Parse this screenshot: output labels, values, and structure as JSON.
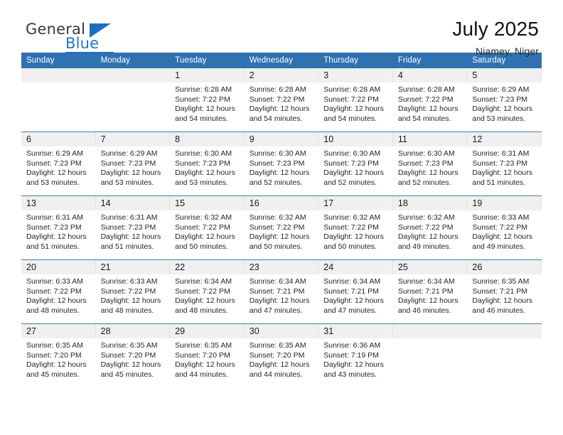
{
  "brand": {
    "name_top": "General",
    "name_bottom": "Blue",
    "accent_color": "#1b6fc0"
  },
  "header": {
    "title": "July 2025",
    "location": "Niamey, Niger",
    "header_bg": "#3071b0",
    "daynum_bg": "#f0f0f0"
  },
  "weekdays": [
    "Sunday",
    "Monday",
    "Tuesday",
    "Wednesday",
    "Thursday",
    "Friday",
    "Saturday"
  ],
  "labels": {
    "sunrise_prefix": "Sunrise:",
    "sunset_prefix": "Sunset:",
    "daylight_prefix": "Daylight:"
  },
  "weeks": [
    [
      {
        "day": "",
        "sunrise": "",
        "sunset": "",
        "daylight": ""
      },
      {
        "day": "",
        "sunrise": "",
        "sunset": "",
        "daylight": ""
      },
      {
        "day": "1",
        "sunrise": "Sunrise: 6:28 AM",
        "sunset": "Sunset: 7:22 PM",
        "daylight": "Daylight: 12 hours and 54 minutes."
      },
      {
        "day": "2",
        "sunrise": "Sunrise: 6:28 AM",
        "sunset": "Sunset: 7:22 PM",
        "daylight": "Daylight: 12 hours and 54 minutes."
      },
      {
        "day": "3",
        "sunrise": "Sunrise: 6:28 AM",
        "sunset": "Sunset: 7:22 PM",
        "daylight": "Daylight: 12 hours and 54 minutes."
      },
      {
        "day": "4",
        "sunrise": "Sunrise: 6:28 AM",
        "sunset": "Sunset: 7:22 PM",
        "daylight": "Daylight: 12 hours and 54 minutes."
      },
      {
        "day": "5",
        "sunrise": "Sunrise: 6:29 AM",
        "sunset": "Sunset: 7:23 PM",
        "daylight": "Daylight: 12 hours and 53 minutes."
      }
    ],
    [
      {
        "day": "6",
        "sunrise": "Sunrise: 6:29 AM",
        "sunset": "Sunset: 7:23 PM",
        "daylight": "Daylight: 12 hours and 53 minutes."
      },
      {
        "day": "7",
        "sunrise": "Sunrise: 6:29 AM",
        "sunset": "Sunset: 7:23 PM",
        "daylight": "Daylight: 12 hours and 53 minutes."
      },
      {
        "day": "8",
        "sunrise": "Sunrise: 6:30 AM",
        "sunset": "Sunset: 7:23 PM",
        "daylight": "Daylight: 12 hours and 53 minutes."
      },
      {
        "day": "9",
        "sunrise": "Sunrise: 6:30 AM",
        "sunset": "Sunset: 7:23 PM",
        "daylight": "Daylight: 12 hours and 52 minutes."
      },
      {
        "day": "10",
        "sunrise": "Sunrise: 6:30 AM",
        "sunset": "Sunset: 7:23 PM",
        "daylight": "Daylight: 12 hours and 52 minutes."
      },
      {
        "day": "11",
        "sunrise": "Sunrise: 6:30 AM",
        "sunset": "Sunset: 7:23 PM",
        "daylight": "Daylight: 12 hours and 52 minutes."
      },
      {
        "day": "12",
        "sunrise": "Sunrise: 6:31 AM",
        "sunset": "Sunset: 7:23 PM",
        "daylight": "Daylight: 12 hours and 51 minutes."
      }
    ],
    [
      {
        "day": "13",
        "sunrise": "Sunrise: 6:31 AM",
        "sunset": "Sunset: 7:23 PM",
        "daylight": "Daylight: 12 hours and 51 minutes."
      },
      {
        "day": "14",
        "sunrise": "Sunrise: 6:31 AM",
        "sunset": "Sunset: 7:23 PM",
        "daylight": "Daylight: 12 hours and 51 minutes."
      },
      {
        "day": "15",
        "sunrise": "Sunrise: 6:32 AM",
        "sunset": "Sunset: 7:22 PM",
        "daylight": "Daylight: 12 hours and 50 minutes."
      },
      {
        "day": "16",
        "sunrise": "Sunrise: 6:32 AM",
        "sunset": "Sunset: 7:22 PM",
        "daylight": "Daylight: 12 hours and 50 minutes."
      },
      {
        "day": "17",
        "sunrise": "Sunrise: 6:32 AM",
        "sunset": "Sunset: 7:22 PM",
        "daylight": "Daylight: 12 hours and 50 minutes."
      },
      {
        "day": "18",
        "sunrise": "Sunrise: 6:32 AM",
        "sunset": "Sunset: 7:22 PM",
        "daylight": "Daylight: 12 hours and 49 minutes."
      },
      {
        "day": "19",
        "sunrise": "Sunrise: 6:33 AM",
        "sunset": "Sunset: 7:22 PM",
        "daylight": "Daylight: 12 hours and 49 minutes."
      }
    ],
    [
      {
        "day": "20",
        "sunrise": "Sunrise: 6:33 AM",
        "sunset": "Sunset: 7:22 PM",
        "daylight": "Daylight: 12 hours and 48 minutes."
      },
      {
        "day": "21",
        "sunrise": "Sunrise: 6:33 AM",
        "sunset": "Sunset: 7:22 PM",
        "daylight": "Daylight: 12 hours and 48 minutes."
      },
      {
        "day": "22",
        "sunrise": "Sunrise: 6:34 AM",
        "sunset": "Sunset: 7:22 PM",
        "daylight": "Daylight: 12 hours and 48 minutes."
      },
      {
        "day": "23",
        "sunrise": "Sunrise: 6:34 AM",
        "sunset": "Sunset: 7:21 PM",
        "daylight": "Daylight: 12 hours and 47 minutes."
      },
      {
        "day": "24",
        "sunrise": "Sunrise: 6:34 AM",
        "sunset": "Sunset: 7:21 PM",
        "daylight": "Daylight: 12 hours and 47 minutes."
      },
      {
        "day": "25",
        "sunrise": "Sunrise: 6:34 AM",
        "sunset": "Sunset: 7:21 PM",
        "daylight": "Daylight: 12 hours and 46 minutes."
      },
      {
        "day": "26",
        "sunrise": "Sunrise: 6:35 AM",
        "sunset": "Sunset: 7:21 PM",
        "daylight": "Daylight: 12 hours and 46 minutes."
      }
    ],
    [
      {
        "day": "27",
        "sunrise": "Sunrise: 6:35 AM",
        "sunset": "Sunset: 7:20 PM",
        "daylight": "Daylight: 12 hours and 45 minutes."
      },
      {
        "day": "28",
        "sunrise": "Sunrise: 6:35 AM",
        "sunset": "Sunset: 7:20 PM",
        "daylight": "Daylight: 12 hours and 45 minutes."
      },
      {
        "day": "29",
        "sunrise": "Sunrise: 6:35 AM",
        "sunset": "Sunset: 7:20 PM",
        "daylight": "Daylight: 12 hours and 44 minutes."
      },
      {
        "day": "30",
        "sunrise": "Sunrise: 6:35 AM",
        "sunset": "Sunset: 7:20 PM",
        "daylight": "Daylight: 12 hours and 44 minutes."
      },
      {
        "day": "31",
        "sunrise": "Sunrise: 6:36 AM",
        "sunset": "Sunset: 7:19 PM",
        "daylight": "Daylight: 12 hours and 43 minutes."
      },
      {
        "day": "",
        "sunrise": "",
        "sunset": "",
        "daylight": ""
      },
      {
        "day": "",
        "sunrise": "",
        "sunset": "",
        "daylight": ""
      }
    ]
  ]
}
